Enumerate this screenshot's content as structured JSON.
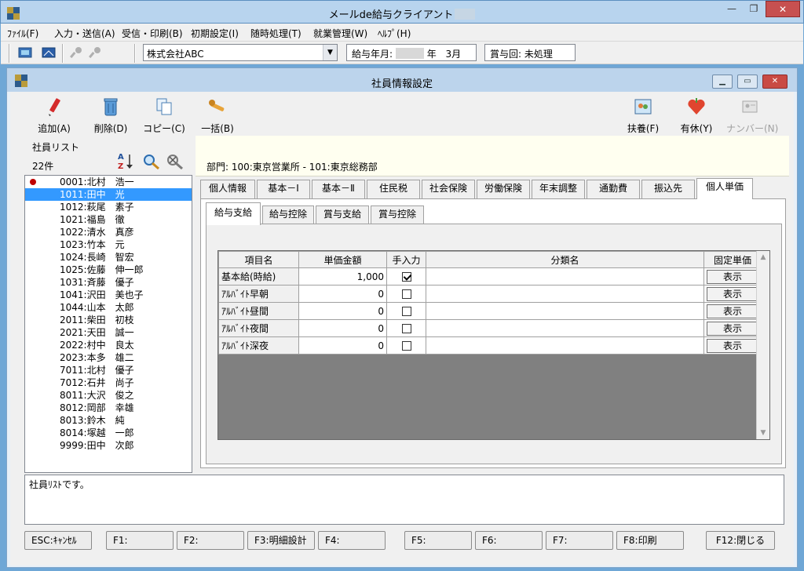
{
  "app": {
    "title": "メールde給与クライアント",
    "menu": [
      "ﾌｧｲﾙ(F)",
      "入力・送信(A)",
      "受信・印刷(B)",
      "初期設定(I)",
      "随時処理(T)",
      "就業管理(W)",
      "ﾍﾙﾌﾟ(H)"
    ],
    "company": "株式会社ABC",
    "pay_month_label": "給与年月:",
    "pay_month_year": "年",
    "pay_month_month": "3月",
    "bonus_label": "賞与回: 未処理"
  },
  "window": {
    "title": "社員情報設定"
  },
  "toolbar": {
    "add": "追加(A)",
    "delete": "削除(D)",
    "copy": "コピー(C)",
    "bulk": "一括(B)",
    "dependents": "扶養(F)",
    "leave": "有休(Y)",
    "number": "ナンバー(N)"
  },
  "employee_list": {
    "title": "社員リスト",
    "count": "22件",
    "items": [
      "0001:北村　浩一",
      "1011:田中　光",
      "1012:萩尾　素子",
      "1021:福島　徹",
      "1022:清水　真彦",
      "1023:竹本　元",
      "1024:長崎　智宏",
      "1025:佐藤　伸一郎",
      "1031:斉藤　優子",
      "1041:沢田　美也子",
      "1044:山本　太郎",
      "2011:柴田　初枝",
      "2021:天田　誠一",
      "2022:村中　良太",
      "2023:本多　雄二",
      "7011:北村　優子",
      "7012:石井　尚子",
      "8011:大沢　俊之",
      "8012:岡部　幸雄",
      "8013:鈴木　純",
      "8014:塚越　一郎",
      "9999:田中　次郎"
    ]
  },
  "department": "部門:  100:東京営業所 - 101:東京総務部",
  "tabs_main": [
    "個人情報",
    "基本－Ⅰ",
    "基本－Ⅱ",
    "住民税",
    "社会保険",
    "労働保険",
    "年末調整",
    "通勤費",
    "振込先",
    "個人単価"
  ],
  "tabs_sub": [
    "給与支給",
    "給与控除",
    "賞与支給",
    "賞与控除"
  ],
  "grid": {
    "headers": [
      "項目名",
      "単価金額",
      "手入力",
      "分類名",
      "固定単価"
    ],
    "rows": [
      {
        "name": "基本給(時給)",
        "amount": "1,000",
        "manual": true,
        "category": "",
        "button": "表示"
      },
      {
        "name": "ｱﾙﾊﾞｲﾄ早朝",
        "amount": "0",
        "manual": false,
        "category": "",
        "button": "表示"
      },
      {
        "name": "ｱﾙﾊﾞｲﾄ昼間",
        "amount": "0",
        "manual": false,
        "category": "",
        "button": "表示"
      },
      {
        "name": "ｱﾙﾊﾞｲﾄ夜間",
        "amount": "0",
        "manual": false,
        "category": "",
        "button": "表示"
      },
      {
        "name": "ｱﾙﾊﾞｲﾄ深夜",
        "amount": "0",
        "manual": false,
        "category": "",
        "button": "表示"
      }
    ]
  },
  "status": "社員ﾘｽﾄです。",
  "fkeys": [
    "ESC:ｷｬﾝｾﾙ",
    "F1:",
    "F2:",
    "F3:明細設計",
    "F4:",
    "F5:",
    "F6:",
    "F7:",
    "F8:印刷",
    "F12:閉じる"
  ]
}
